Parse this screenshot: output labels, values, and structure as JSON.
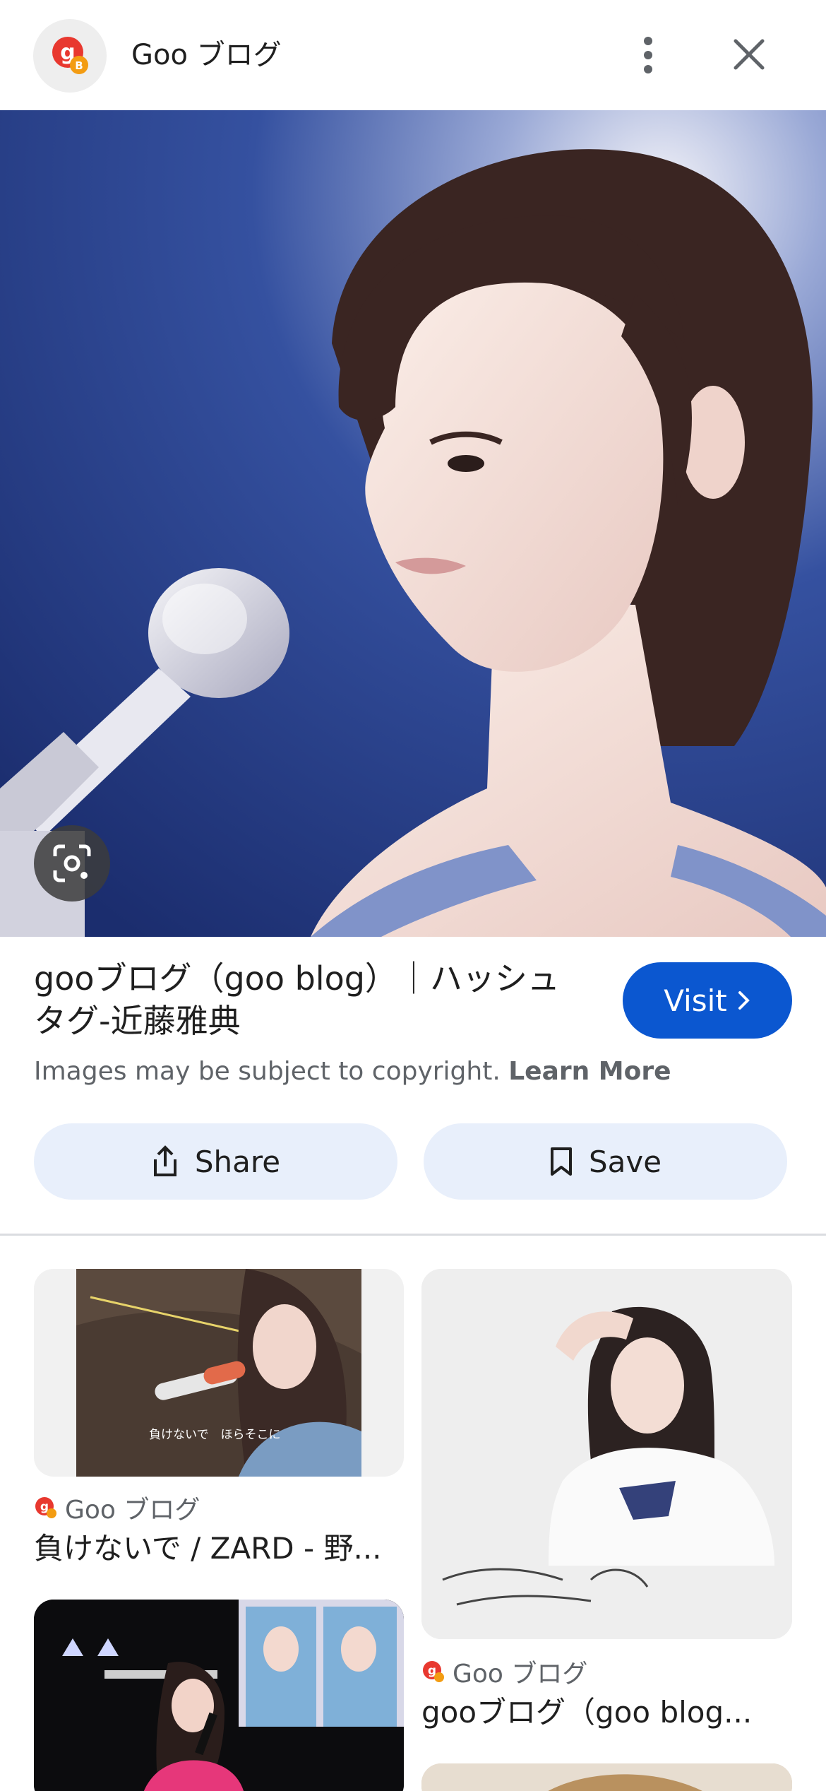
{
  "header": {
    "site_name": "Goo ブログ",
    "menu_icon": "more-vert-icon",
    "close_icon": "close-icon"
  },
  "hero": {
    "lens_icon": "google-lens-icon"
  },
  "result": {
    "title": "gooブログ（goo blog）｜ハッシュタグ-近藤雅典",
    "visit_label": "Visit",
    "copyright_text": "Images may be subject to copyright.",
    "learn_more_label": "Learn More",
    "share_label": "Share",
    "save_label": "Save"
  },
  "colors": {
    "accent": "#0b57d0",
    "button_bg": "#e8effb",
    "brand_red": "#e8382f"
  },
  "related": [
    {
      "source": "Goo ブログ",
      "title": "負けないで / ZARD - 野...",
      "caption_in_image": "負けないで　ほらそこに"
    },
    {
      "source": "Goo ブログ",
      "title": "gooブログ（goo blog..."
    },
    {
      "source": "",
      "title": ""
    },
    {
      "source": "",
      "title": ""
    }
  ]
}
